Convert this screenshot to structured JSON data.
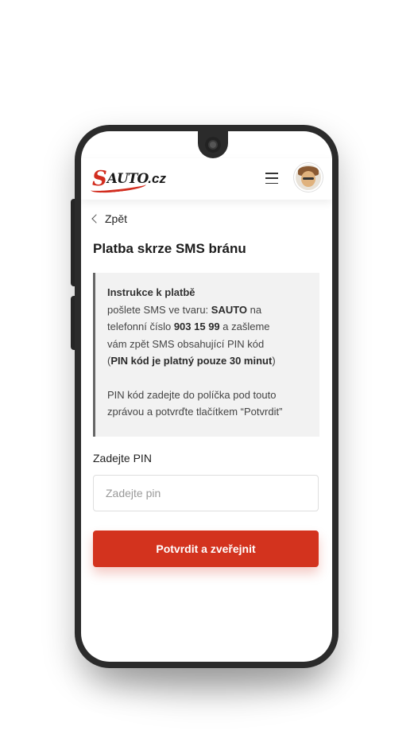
{
  "header": {
    "logo_s": "S",
    "logo_auto": "AUTO",
    "logo_cz": ".cz",
    "menu_icon": "hamburger-menu-icon",
    "avatar_icon": "user-avatar"
  },
  "nav": {
    "back_label": "Zpět"
  },
  "page": {
    "title": "Platba skrze SMS bránu"
  },
  "instructions": {
    "heading": "Instrukce k platbě",
    "line1_prefix": "pošlete SMS ve tvaru: ",
    "sms_text": "SAUTO",
    "line1_suffix": " na",
    "line2_prefix": "telefonní číslo ",
    "phone_number": "903 15 99",
    "line2_suffix": " a zašleme",
    "line3": "vám zpět SMS obsahující PIN kód",
    "validity_open": "(",
    "validity": "PIN kód je platný pouze 30 minut",
    "validity_close": ")",
    "note_line1": "PIN kód zadejte do políčka pod touto",
    "note_line2": "zprávou a potvrďte tlačítkem “Potvrdit”"
  },
  "form": {
    "pin_label": "Zadejte PIN",
    "pin_placeholder": "Zadejte pin",
    "pin_value": "",
    "submit_label": "Potvrdit a zveřejnit"
  },
  "colors": {
    "accent": "#d3331e",
    "panel_bg": "#f2f2f2",
    "panel_border": "#666666"
  }
}
